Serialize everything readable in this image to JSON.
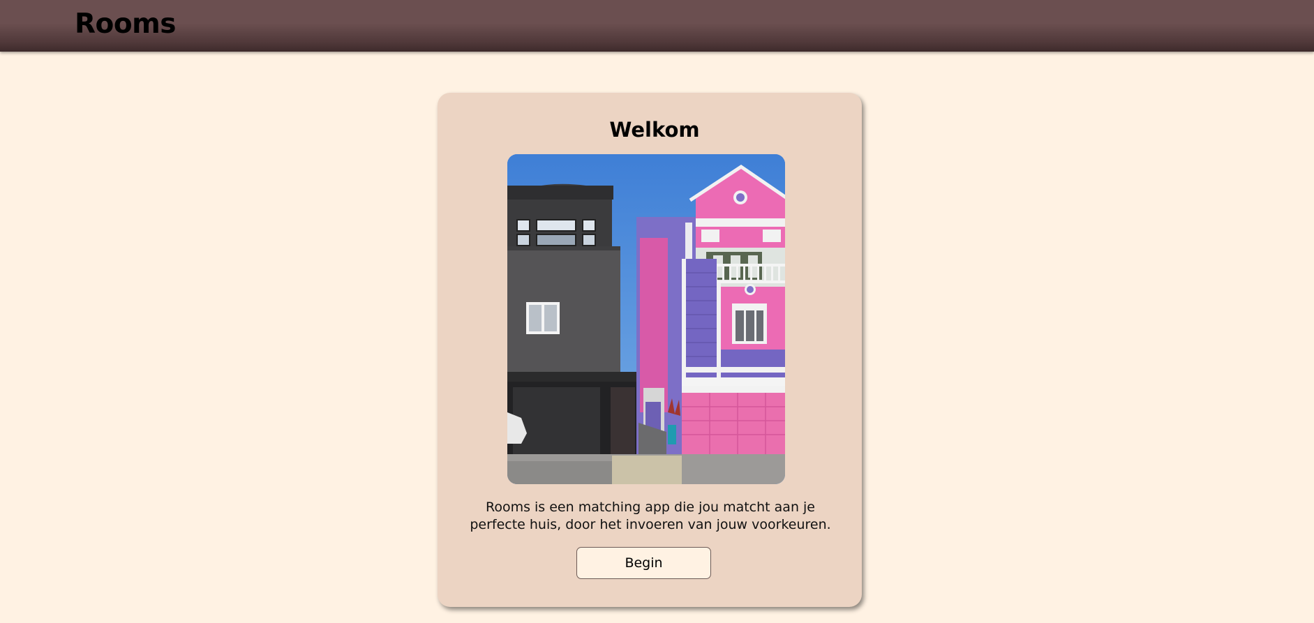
{
  "header": {
    "title": "Rooms"
  },
  "welcome_card": {
    "heading": "Welkom",
    "image": {
      "alt": "house-photo"
    },
    "description": "Rooms is een matching app die jou matcht aan je perfecte huis, door het invoeren van jouw voorkeuren.",
    "begin_label": "Begin"
  },
  "colors": {
    "page_background": "#fff2e3",
    "header_background": "#6b4f50",
    "card_background": "#ecd4c3",
    "button_background": "#fff2e3"
  }
}
